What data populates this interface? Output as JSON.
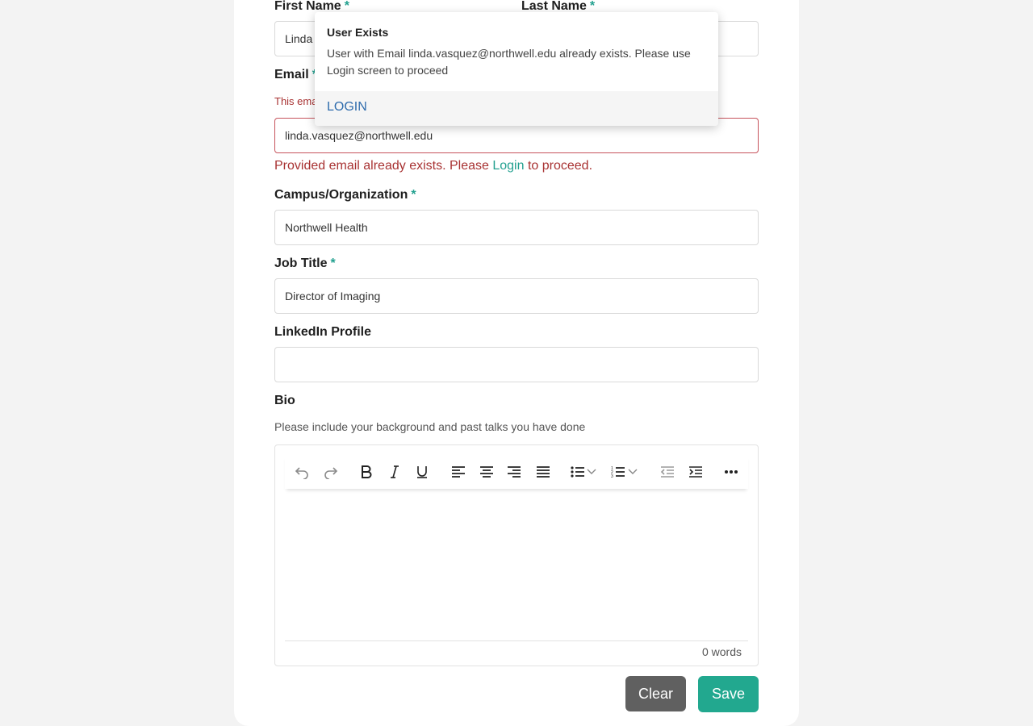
{
  "form": {
    "first_name": {
      "label": "First Name",
      "required": "*",
      "value": "Linda"
    },
    "last_name": {
      "label": "Last Name",
      "required": "*",
      "value": ""
    },
    "email": {
      "label": "Email",
      "required": "*",
      "value": "linda.vasquez@northwell.edu",
      "inline_error_prefix": "This ema",
      "error_before": "Provided email already exists. Please ",
      "error_link": "Login",
      "error_after": " to proceed."
    },
    "campus": {
      "label": "Campus/Organization",
      "required": "*",
      "value": "Northwell Health"
    },
    "job_title": {
      "label": "Job Title",
      "required": "*",
      "value": "Director of Imaging"
    },
    "linkedin": {
      "label": "LinkedIn Profile",
      "value": ""
    },
    "bio": {
      "label": "Bio",
      "hint": "Please include your background and past talks you have done",
      "word_count": "0 words",
      "toolbar": [
        "undo-icon",
        "redo-icon",
        "bold-icon",
        "italic-icon",
        "underline-icon",
        "align-left-icon",
        "align-center-icon",
        "align-right-icon",
        "align-justify-icon",
        "bullet-list-icon",
        "numbered-list-icon",
        "outdent-icon",
        "indent-icon",
        "more-icon"
      ]
    },
    "buttons": {
      "clear": "Clear",
      "save": "Save"
    }
  },
  "popup": {
    "title": "User Exists",
    "message": "User with Email linda.vasquez@northwell.edu already exists. Please use Login screen to proceed",
    "action": "LOGIN"
  },
  "colors": {
    "accent": "#22a88f",
    "required": "#22a08f",
    "error": "#a83232",
    "error_border": "#c6535c",
    "link_blue": "#2f6cad",
    "clear_button": "#606060",
    "page_bg": "#f3f3f3"
  }
}
